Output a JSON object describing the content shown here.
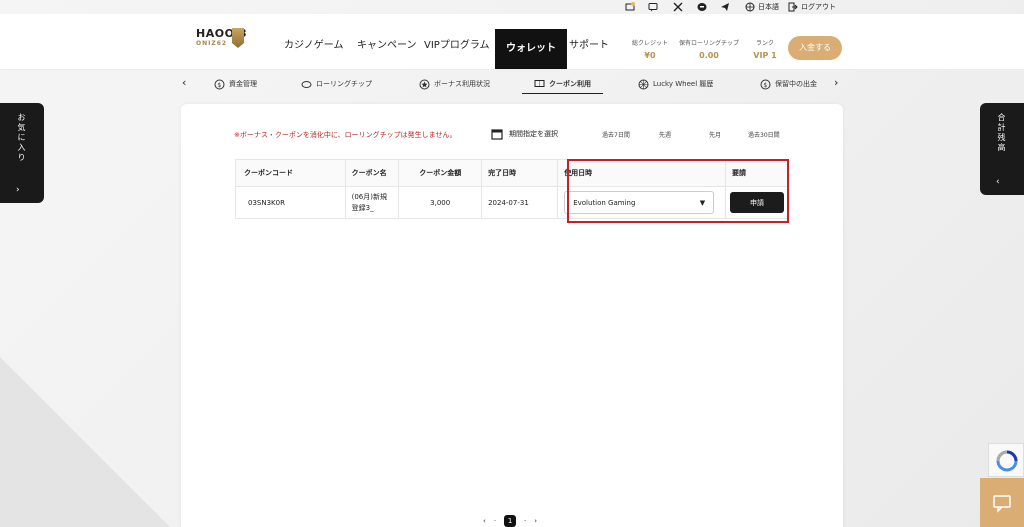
{
  "topbar": {
    "language": "日本語",
    "logout": "ログアウト"
  },
  "header": {
    "logo": "HAOOJ3",
    "logo_sub": "ONIZ62",
    "nav": [
      "カジノゲーム",
      "キャンペーン",
      "VIPプログラム",
      "ウォレット",
      "サポート"
    ],
    "active_nav": "ウォレット",
    "stats": [
      {
        "label": "総クレジット",
        "value": "¥0"
      },
      {
        "label": "保有ローリングチップ",
        "value": "0.00"
      },
      {
        "label": "ランク",
        "value": "VIP 1"
      }
    ],
    "deposit_label": "入金する"
  },
  "subnav": {
    "items": [
      "資金管理",
      "ローリングチップ",
      "ボーナス利用状況",
      "クーポン利用",
      "Lucky Wheel 履歴",
      "保留中の出金"
    ],
    "active": "クーポン利用"
  },
  "side": {
    "left": "お気に入り",
    "right": "合計残高"
  },
  "notice": "※ボーナス・クーポンを消化中に、ローリングチップは発生しません。",
  "period": {
    "label": "期間指定を選択",
    "ranges": [
      "過去7日間",
      "先週",
      "先月",
      "過去30日間"
    ]
  },
  "table": {
    "headers": [
      "クーポンコード",
      "クーポン名",
      "クーポン金額",
      "完了日時",
      "使用日時",
      "要請"
    ],
    "row": {
      "code": "03SN3K0R",
      "name": "(06月)新規登録3_",
      "amount": "3,000",
      "date": "2024-07-31",
      "select_value": "Evolution Gaming",
      "apply_label": "申請"
    }
  },
  "pager": {
    "current": "1"
  },
  "colors": {
    "accent": "#d9ad74",
    "highlight": "#c81e2a",
    "notice": "#b22a2a"
  }
}
